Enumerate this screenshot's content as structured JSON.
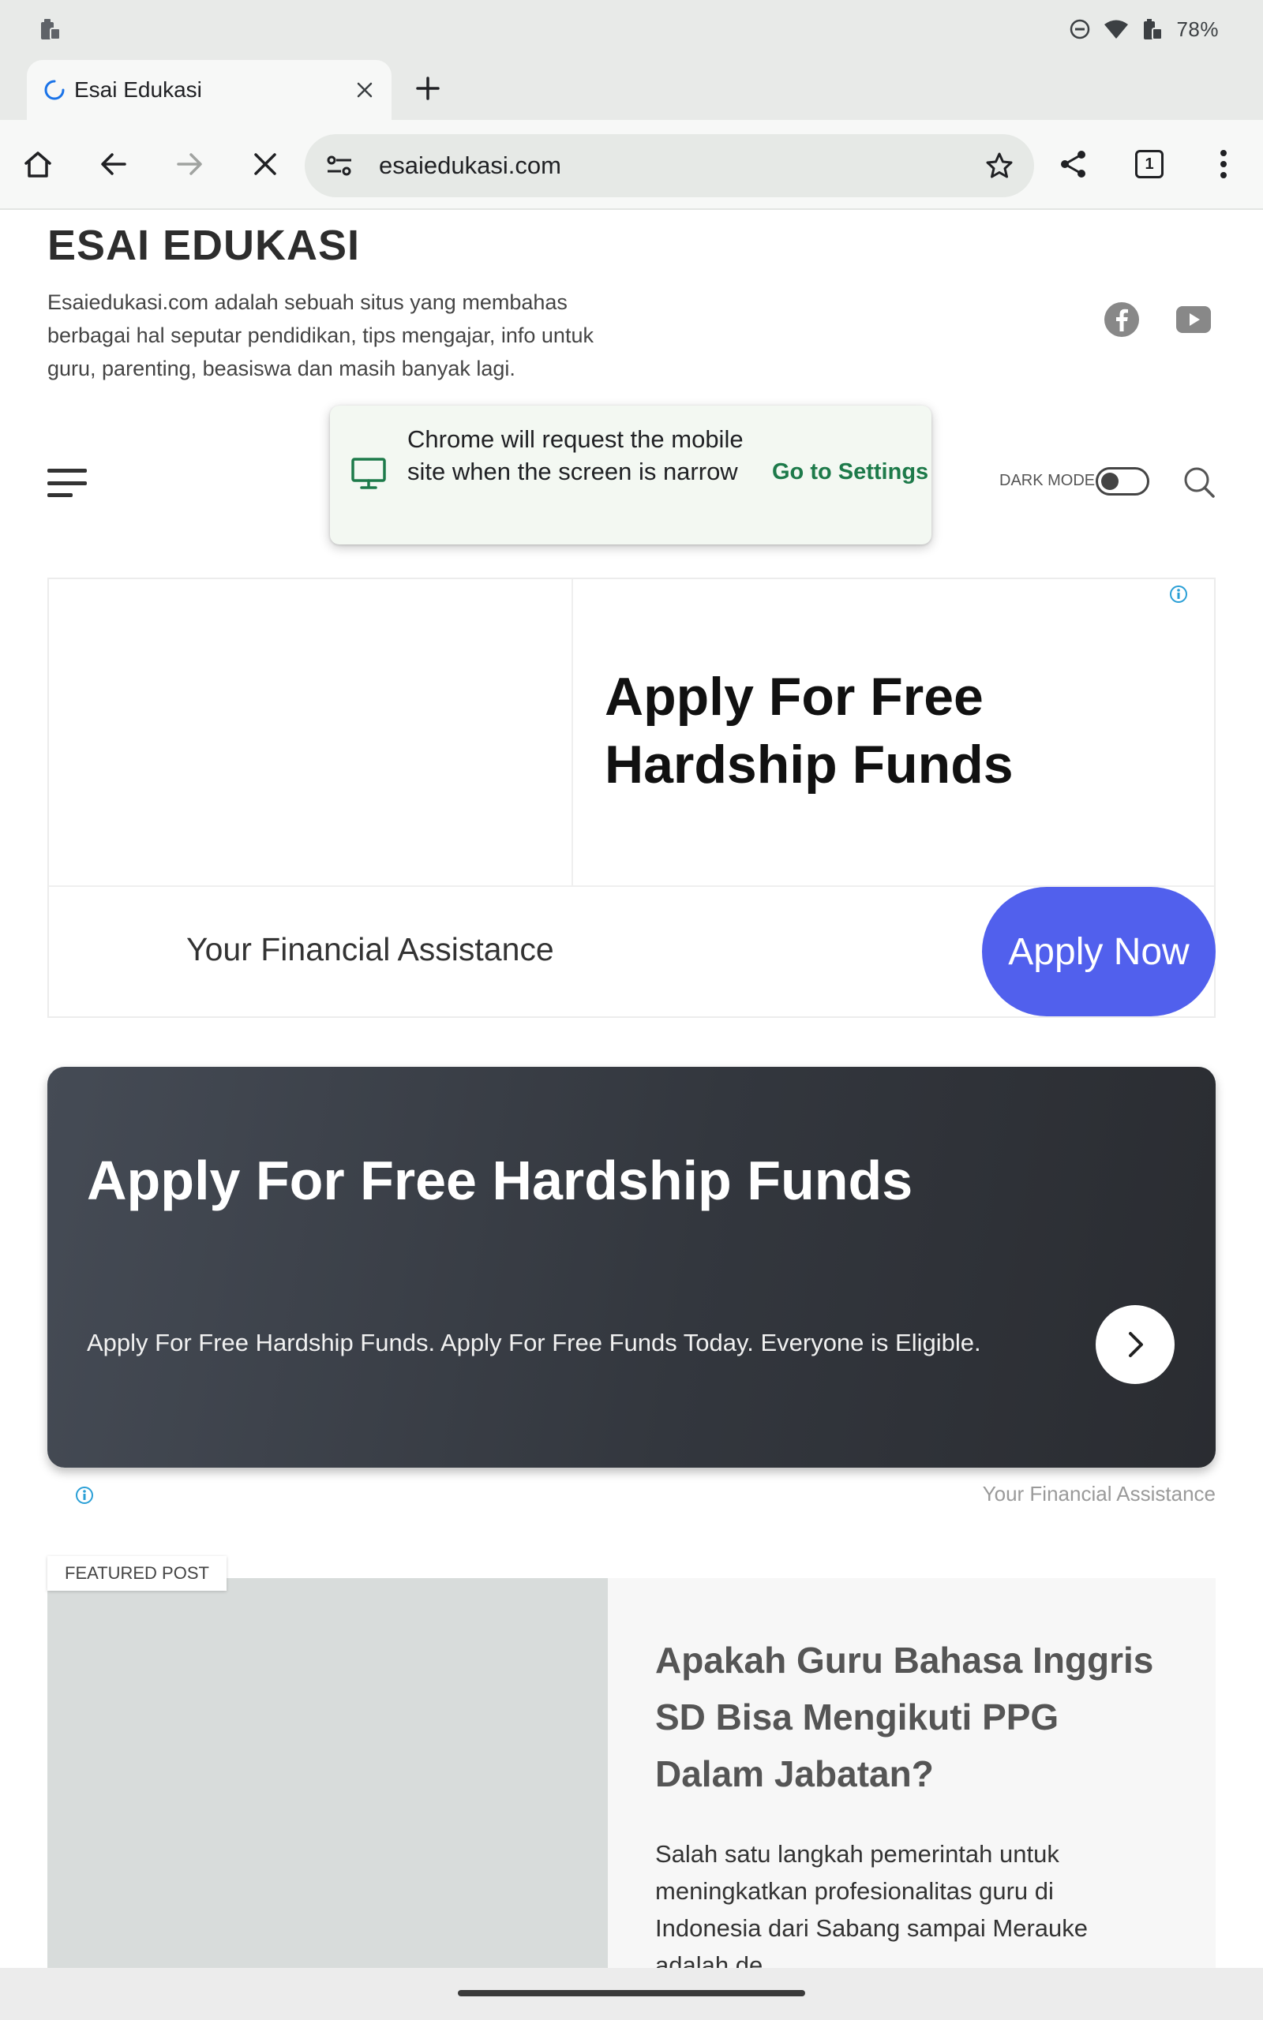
{
  "status_bar": {
    "battery": "78%"
  },
  "browser": {
    "tab": {
      "title": "Esai Edukasi"
    },
    "omnibox": {
      "url": "esaiedukasi.com"
    },
    "tab_count": "1"
  },
  "popup": {
    "message": "Chrome will request the mobile site when the screen is narrow",
    "action": "Go to Settings"
  },
  "site": {
    "title": "ESAI EDUKASI",
    "description": "Esaiedukasi.com adalah sebuah situs yang membahas berbagai hal seputar pendidikan, tips mengajar, info untuk guru, parenting, beasiswa dan masih banyak lagi.",
    "dark_mode_label": "DARK MODE"
  },
  "ad1": {
    "headline": "Apply For Free Hardship Funds",
    "advertiser": "Your Financial Assistance",
    "cta": "Apply Now",
    "cta_color": "#5160ed"
  },
  "ad2": {
    "headline": "Apply For Free Hardship Funds",
    "body": "Apply For Free Hardship Funds. Apply For Free Funds Today. Everyone is Eligible.",
    "advertiser": "Your Financial Assistance"
  },
  "featured": {
    "label": "FEATURED POST",
    "title": "Apakah Guru Bahasa Inggris SD Bisa Mengikuti PPG Dalam Jabatan?",
    "excerpt": "Salah satu langkah pemerintah untuk meningkatkan profesionalitas guru di Indonesia dari Sabang sampai Merauke adalah de..."
  },
  "colors": {
    "accent_green": "#1d7a4a",
    "ad_dark": "#33373e"
  }
}
